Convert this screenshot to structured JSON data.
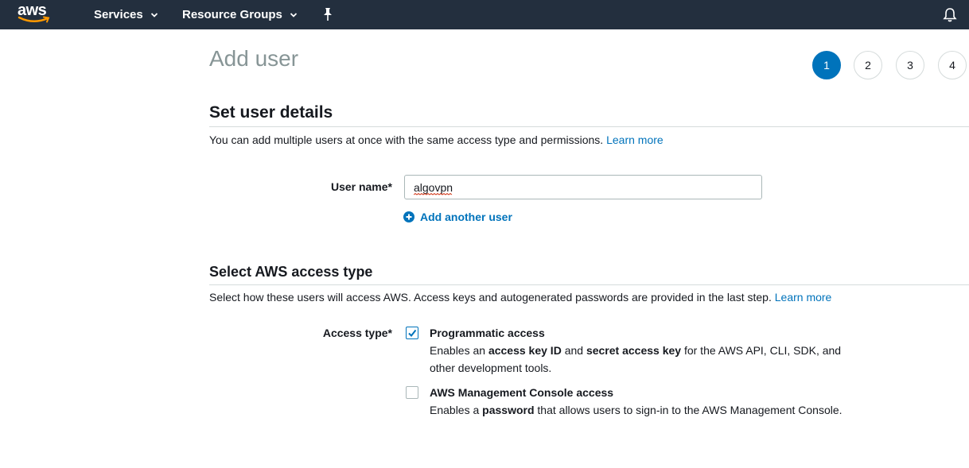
{
  "topnav": {
    "logo_text": "aws",
    "services_label": "Services",
    "resource_groups_label": "Resource Groups"
  },
  "page": {
    "title": "Add user"
  },
  "steps": [
    "1",
    "2",
    "3",
    "4"
  ],
  "active_step": "1",
  "set_user_details": {
    "title": "Set user details",
    "description": "You can add multiple users at once with the same access type and permissions.",
    "learn_more": "Learn more",
    "user_name_label": "User name*",
    "user_name_value": "algovpn",
    "add_another_user": "Add another user"
  },
  "access_type_section": {
    "title": "Select AWS access type",
    "description": "Select how these users will access AWS. Access keys and autogenerated passwords are provided in the last step.",
    "learn_more": "Learn more",
    "access_type_label": "Access type*",
    "options": [
      {
        "title": "Programmatic access",
        "checked": true,
        "desc_parts": [
          "Enables an ",
          "access key ID",
          " and ",
          "secret access key",
          " for the AWS API, CLI, SDK, and other development tools."
        ]
      },
      {
        "title": "AWS Management Console access",
        "checked": false,
        "desc_parts": [
          "Enables a ",
          "password",
          " that allows users to sign-in to the AWS Management Console."
        ]
      }
    ]
  },
  "colors": {
    "nav_bg": "#232f3e",
    "accent": "#0073bb",
    "title_gray": "#879596",
    "amazon_orange": "#ff9900"
  }
}
